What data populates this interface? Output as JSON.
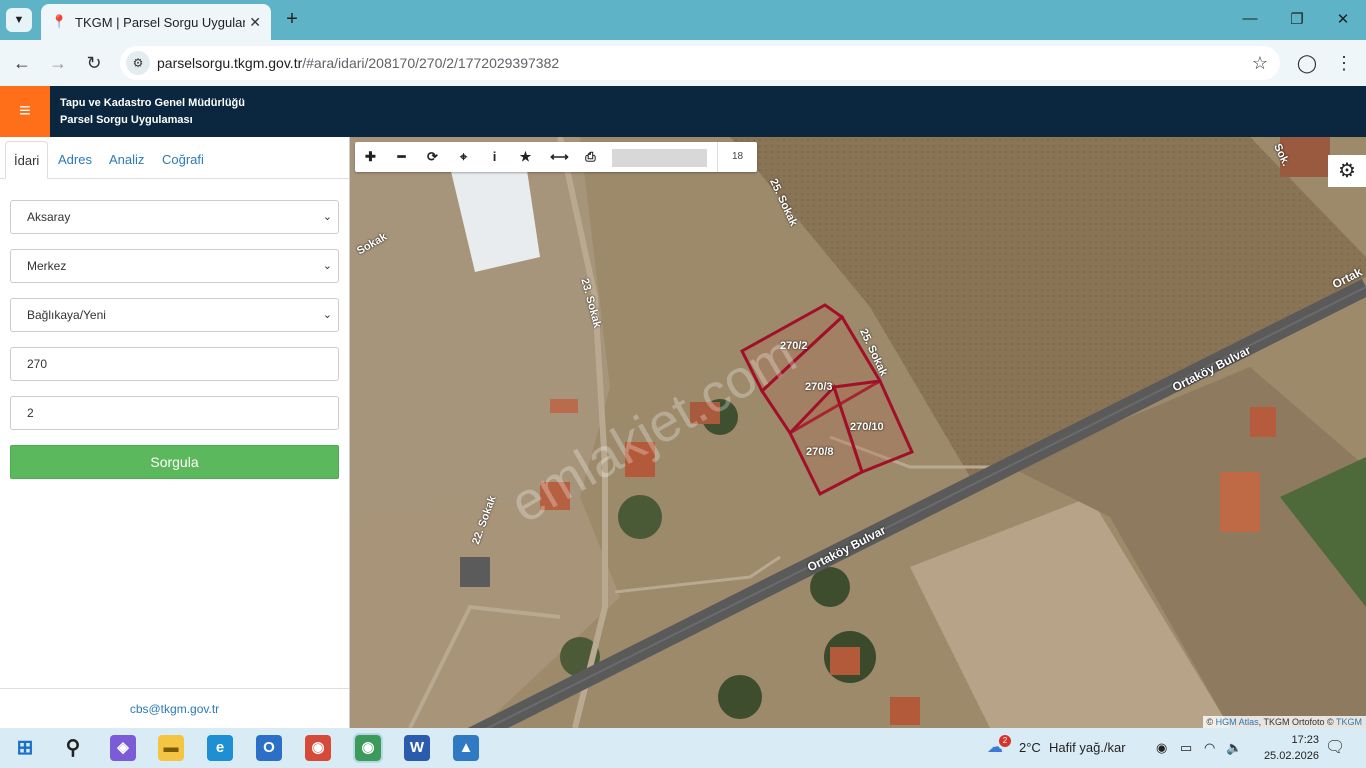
{
  "browser": {
    "tab_title": "TKGM | Parsel Sorgu Uygulaması",
    "new_tab": "+",
    "url_host": "parselsorgu.tkgm.gov.tr",
    "url_path": "/#ara/idari/208170/270/2/1772029397382"
  },
  "app": {
    "title_line1": "Tapu ve Kadastro Genel Müdürlüğü",
    "title_line2": "Parsel Sorgu Uygulaması"
  },
  "sidebar": {
    "tabs": [
      {
        "label": "İdari"
      },
      {
        "label": "Adres"
      },
      {
        "label": "Analiz"
      },
      {
        "label": "Coğrafi"
      }
    ],
    "il": "Aksaray",
    "ilce": "Merkez",
    "mahalle": "Bağlıkaya/Yeni",
    "ada": "270",
    "parsel": "2",
    "submit_label": "Sorgula",
    "footer_email": "cbs@tkgm.gov.tr"
  },
  "map": {
    "zoom_level": "18",
    "parcels": [
      "270/2",
      "270/3",
      "270/10",
      "270/8"
    ],
    "streets": [
      "25. Sokak",
      "23. Sokak",
      "22. Sokak",
      "Ortaköy Bulvar",
      "Ortaköy Bulvar",
      "Sokak",
      "Sok.",
      "Ortak",
      "25. Sokak"
    ],
    "watermark": "emlakjet.com",
    "parcel_border_color": "#a01028",
    "attribution_prefix": "© ",
    "attribution_link1": "HGM Atlas",
    "attribution_mid": ", TKGM Ortofoto © ",
    "attribution_link2": "TKGM"
  },
  "taskbar": {
    "weather_temp": "2°C",
    "weather_desc": "Hafif yağ./kar",
    "weather_badge": "2",
    "time": "17:23",
    "date": "25.02.2026"
  }
}
